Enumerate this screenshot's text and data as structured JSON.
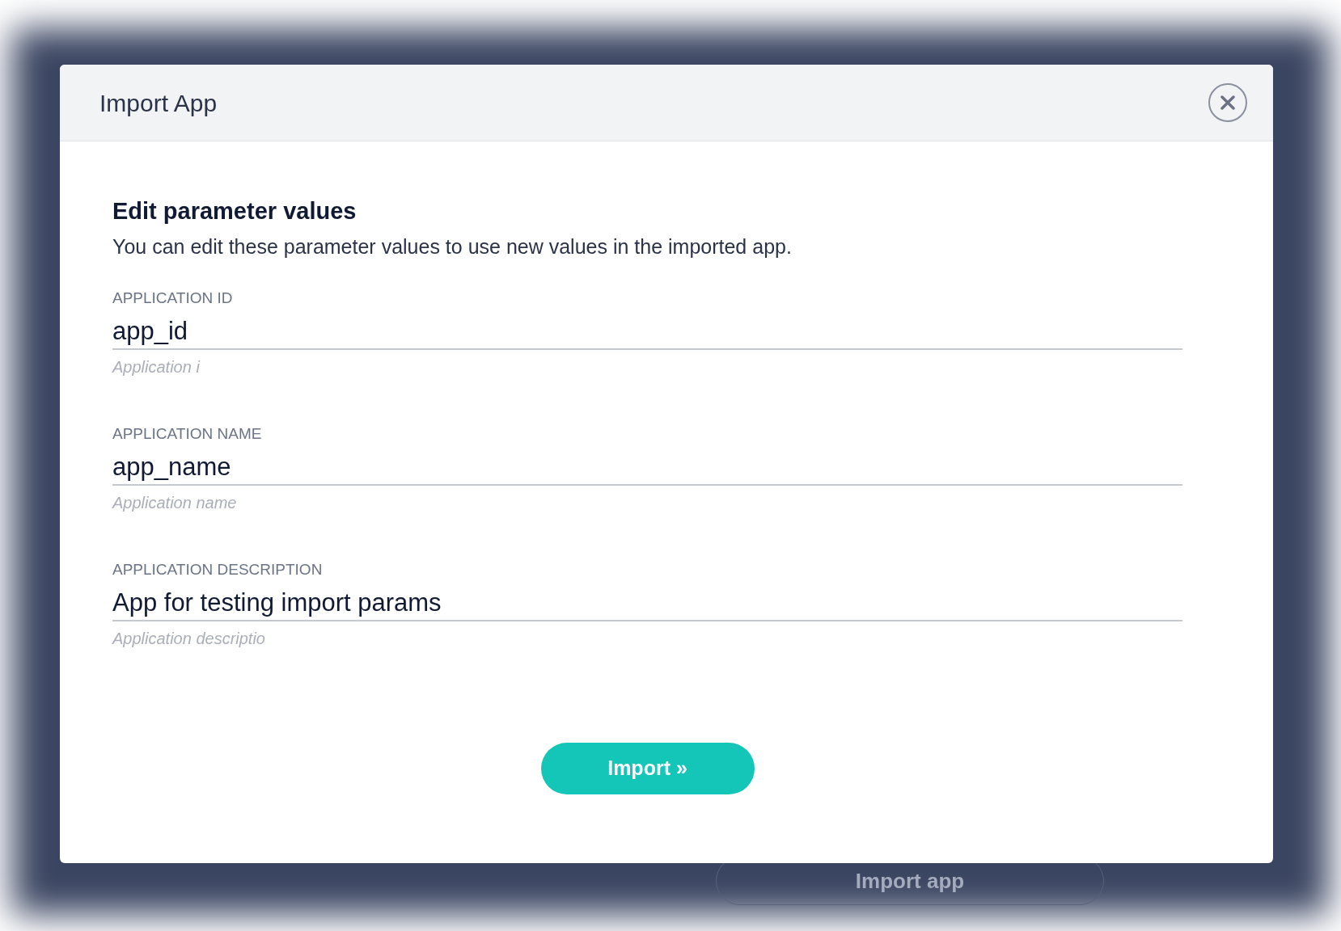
{
  "background": {
    "button": "Import app"
  },
  "dialog": {
    "title": "Import App",
    "heading": "Edit parameter values",
    "description": "You can edit these parameter values to use new values in the imported app.",
    "fields": [
      {
        "label": "APPLICATION ID",
        "value": "app_id",
        "hint": "Application i"
      },
      {
        "label": "APPLICATION NAME",
        "value": "app_name",
        "hint": "Application name"
      },
      {
        "label": "APPLICATION DESCRIPTION",
        "value": "App for testing import params",
        "hint": "Application descriptio"
      }
    ],
    "button": "Import »"
  }
}
